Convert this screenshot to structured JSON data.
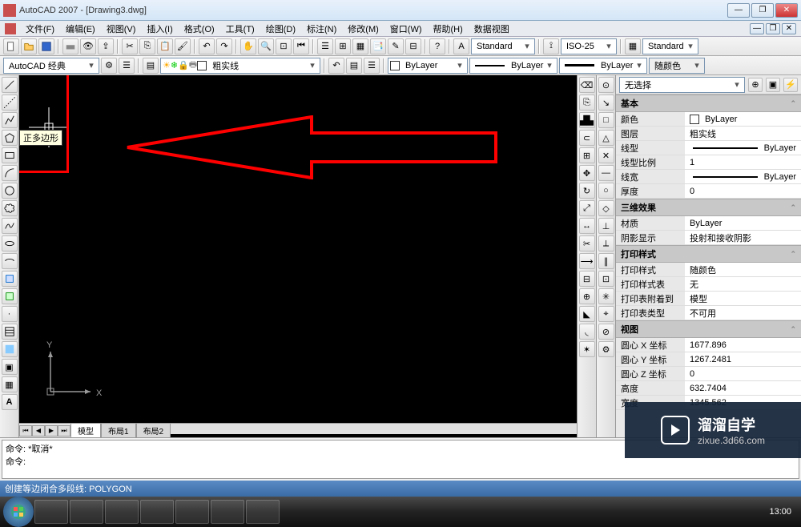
{
  "window": {
    "title": "AutoCAD 2007 - [Drawing3.dwg]",
    "time": "13:00"
  },
  "menu": {
    "file": "文件(F)",
    "edit": "编辑(E)",
    "view": "视图(V)",
    "insert": "插入(I)",
    "format": "格式(O)",
    "tools": "工具(T)",
    "draw": "绘图(D)",
    "dimension": "标注(N)",
    "modify": "修改(M)",
    "window": "窗口(W)",
    "help": "帮助(H)",
    "data": "数据视图"
  },
  "toolbar2": {
    "workspace": "AutoCAD 经典",
    "layer": "粗实线",
    "standard1": "Standard",
    "dimstyle": "ISO-25",
    "standard2": "Standard"
  },
  "toolbar3": {
    "colortype": "ByLayer",
    "linetype": "ByLayer",
    "lineweight": "ByLayer",
    "plotcolor": "随颜色"
  },
  "tooltip": "正多边形",
  "tabs": {
    "model": "模型",
    "layout1": "布局1",
    "layout2": "布局2"
  },
  "cmd": {
    "hist": "命令: *取消*",
    "prompt": "命令:"
  },
  "status": {
    "text": "创建等边闭合多段线:    POLYGON"
  },
  "props": {
    "noselect": "无选择",
    "sections": {
      "basic": "基本",
      "threed": "三维效果",
      "plot": "打印样式",
      "view": "视图"
    },
    "labels": {
      "color": "颜色",
      "layer": "图层",
      "linetype": "线型",
      "ltscale": "线型比例",
      "lineweight": "线宽",
      "thickness": "厚度",
      "material": "材质",
      "shadow": "阴影显示",
      "plotstyle": "打印样式",
      "plottable": "打印样式表",
      "plotattach": "打印表附着到",
      "plottype": "打印表类型",
      "centerx": "圆心 X 坐标",
      "centery": "圆心 Y 坐标",
      "centerz": "圆心 Z 坐标",
      "height": "高度",
      "width": "宽度"
    },
    "values": {
      "color": "ByLayer",
      "layer": "粗实线",
      "linetype": "ByLayer",
      "ltscale": "1",
      "lineweight": "ByLayer",
      "thickness": "0",
      "material": "ByLayer",
      "shadow": "投射和接收阴影",
      "plotstyle": "随颜色",
      "plottable": "无",
      "plotattach": "模型",
      "plottype": "不可用",
      "centerx": "1677.896",
      "centery": "1267.2481",
      "centerz": "0",
      "height": "632.7404",
      "width": "1345.562"
    }
  },
  "watermark": {
    "brand": "溜溜自学",
    "url": "zixue.3d66.com"
  }
}
